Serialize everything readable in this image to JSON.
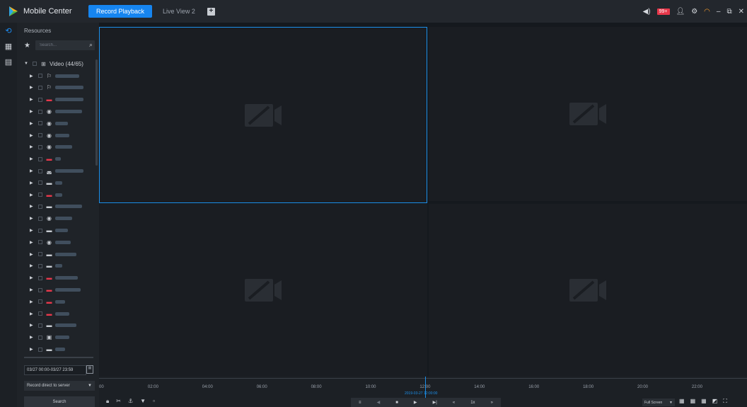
{
  "app": {
    "title": "Mobile Center"
  },
  "tabs": [
    {
      "label": "Record Playback",
      "active": true
    },
    {
      "label": "Live View 2",
      "active": false
    }
  ],
  "top_right": {
    "badge": "99+"
  },
  "panel": {
    "title": "Resources",
    "search_placeholder": "Search...",
    "root": {
      "label": "Video (44/65)"
    },
    "nodes": [
      {
        "icon": "org",
        "w": 34
      },
      {
        "icon": "org",
        "w": 40
      },
      {
        "icon": "rec",
        "w": 40
      },
      {
        "icon": "cam",
        "w": 38
      },
      {
        "icon": "cam",
        "w": 18
      },
      {
        "icon": "cam",
        "w": 20
      },
      {
        "icon": "cam",
        "w": 24
      },
      {
        "icon": "rec",
        "w": 8
      },
      {
        "icon": "dome",
        "w": 40
      },
      {
        "icon": "box",
        "w": 10
      },
      {
        "icon": "rec",
        "w": 10
      },
      {
        "icon": "box",
        "w": 38
      },
      {
        "icon": "cam",
        "w": 24
      },
      {
        "icon": "box",
        "w": 18
      },
      {
        "icon": "cam",
        "w": 22
      },
      {
        "icon": "box",
        "w": 30
      },
      {
        "icon": "box",
        "w": 10
      },
      {
        "icon": "rec",
        "w": 32
      },
      {
        "icon": "rec",
        "w": 36
      },
      {
        "icon": "rec",
        "w": 14
      },
      {
        "icon": "rec",
        "w": 20
      },
      {
        "icon": "box",
        "w": 30
      },
      {
        "icon": "nvr",
        "w": 20
      },
      {
        "icon": "box",
        "w": 14
      }
    ],
    "date_range": "03/27 00:00-03/27 23:59",
    "record_source": "Record direct to server",
    "search_button": "Search"
  },
  "timeline": {
    "labels": [
      "00",
      "02:00",
      "04:00",
      "06:00",
      "08:00",
      "10:00",
      "12:00",
      "14:00",
      "16:00",
      "18:00",
      "20:00",
      "22:00"
    ],
    "current_time": "2019-03-27 12:00:00"
  },
  "controls": {
    "speed": "1x",
    "screen_mode": "Full Screen"
  }
}
